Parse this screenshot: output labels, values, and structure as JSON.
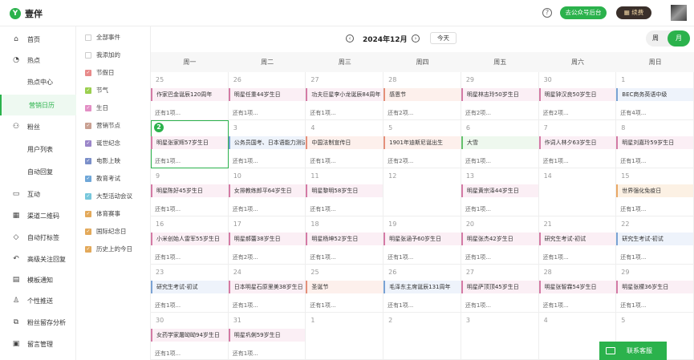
{
  "app": {
    "name": "壹伴",
    "logo_glyph": "Y"
  },
  "topbar": {
    "help_icon": "?",
    "back_button": "去公众号后台",
    "renew_button": "续费"
  },
  "sidebar": {
    "items": [
      {
        "icon": "⌂",
        "label": "首页"
      },
      {
        "icon": "◔",
        "label": "热点"
      },
      {
        "icon": "",
        "label": "热点中心"
      },
      {
        "icon": "",
        "label": "营销日历"
      },
      {
        "icon": "⚇",
        "label": "粉丝"
      },
      {
        "icon": "",
        "label": "用户列表"
      },
      {
        "icon": "",
        "label": "自动回复"
      },
      {
        "icon": "▭",
        "label": "互动"
      },
      {
        "icon": "▦",
        "label": "渠道二维码"
      },
      {
        "icon": "◇",
        "label": "自动打标签"
      },
      {
        "icon": "↶",
        "label": "高级关注回复"
      },
      {
        "icon": "▤",
        "label": "模板通知"
      },
      {
        "icon": "♙",
        "label": "个性推送"
      },
      {
        "icon": "⧉",
        "label": "粉丝留存分析"
      },
      {
        "icon": "▣",
        "label": "留言管理"
      }
    ]
  },
  "filters": [
    {
      "label": "全部事件",
      "checked": false,
      "color": "#ffffff"
    },
    {
      "label": "我添加的",
      "checked": false,
      "color": "#ffffff"
    },
    {
      "label": "节假日",
      "checked": true,
      "color": "#e88a8a"
    },
    {
      "label": "节气",
      "checked": true,
      "color": "#9bcf4f"
    },
    {
      "label": "生日",
      "checked": true,
      "color": "#e38fc5"
    },
    {
      "label": "营销节点",
      "checked": true,
      "color": "#c9a092"
    },
    {
      "label": "诞世纪念",
      "checked": true,
      "color": "#9b86c9"
    },
    {
      "label": "电影上映",
      "checked": true,
      "color": "#7b8fc9"
    },
    {
      "label": "教育考试",
      "checked": true,
      "color": "#6fa7d8"
    },
    {
      "label": "大型活动会议",
      "checked": true,
      "color": "#77c7dc"
    },
    {
      "label": "体育赛事",
      "checked": true,
      "color": "#e3a95a"
    },
    {
      "label": "国际纪念日",
      "checked": true,
      "color": "#e3a95a"
    },
    {
      "label": "历史上的今日",
      "checked": true,
      "color": "#e3a95a"
    }
  ],
  "calendar": {
    "month_title": "2024年12月",
    "prev": "‹",
    "next": "›",
    "today_label": "今天",
    "view_week": "周",
    "view_month": "月",
    "weekdays": [
      "周一",
      "周二",
      "周三",
      "周四",
      "周五",
      "周六",
      "周日"
    ],
    "cells": [
      {
        "day": "25",
        "event": "作家巴金诞辰120周年",
        "more": "还有1项...",
        "style": ""
      },
      {
        "day": "26",
        "event": "明星任重44岁生日",
        "more": "还有1项...",
        "style": ""
      },
      {
        "day": "27",
        "event": "功夫巨星李小龙诞辰84周年",
        "more": "还有1项...",
        "style": ""
      },
      {
        "day": "28",
        "event": "感恩节",
        "more": "还有2项...",
        "style": "c-red"
      },
      {
        "day": "29",
        "event": "明星林志玲50岁生日",
        "more": "还有2项...",
        "style": ""
      },
      {
        "day": "30",
        "event": "明星钟汉良50岁生日",
        "more": "还有2项...",
        "style": ""
      },
      {
        "day": "1",
        "event": "BEC商务英语中级",
        "more": "还有4项...",
        "style": "c-gray"
      },
      {
        "day": "2",
        "event": "明星张家辉57岁生日",
        "more": "还有1项...",
        "style": "",
        "today": true
      },
      {
        "day": "3",
        "event": "公务员国考、日本语能力测试",
        "more": "还有1项...",
        "style": "c-gray"
      },
      {
        "day": "4",
        "event": "中国法制宣传日",
        "more": "还有1项...",
        "style": "c-red"
      },
      {
        "day": "5",
        "event": "1901年迪斯尼诞出生",
        "more": "还有2项...",
        "style": "c-red"
      },
      {
        "day": "6",
        "event": "大雪",
        "more": "还有1项...",
        "style": "c-green"
      },
      {
        "day": "7",
        "event": "作词人林夕63岁生日",
        "more": "还有1项...",
        "style": ""
      },
      {
        "day": "8",
        "event": "明星刘嘉玲59岁生日",
        "more": "还有1项...",
        "style": ""
      },
      {
        "day": "9",
        "event": "明星陈好45岁生日",
        "more": "还有1项...",
        "style": ""
      },
      {
        "day": "10",
        "event": "女排教练郎平64岁生日",
        "more": "还有1项...",
        "style": ""
      },
      {
        "day": "11",
        "event": "明星黎明58岁生日",
        "more": "还有1项...",
        "style": ""
      },
      {
        "day": "12",
        "event": "",
        "more": "",
        "style": ""
      },
      {
        "day": "13",
        "event": "明星黄宗泽44岁生日",
        "more": "还有1项...",
        "style": ""
      },
      {
        "day": "14",
        "event": "",
        "more": "",
        "style": ""
      },
      {
        "day": "15",
        "event": "世界强化免疫日",
        "more": "还有1项...",
        "style": "c-orange"
      },
      {
        "day": "16",
        "event": "小米创始人雷军55岁生日",
        "more": "还有1项...",
        "style": ""
      },
      {
        "day": "17",
        "event": "明星郝蕾38岁生日",
        "more": "还有2项...",
        "style": ""
      },
      {
        "day": "18",
        "event": "明星杨坤52岁生日",
        "more": "还有1项...",
        "style": ""
      },
      {
        "day": "19",
        "event": "明星张涵予60岁生日",
        "more": "还有1项...",
        "style": ""
      },
      {
        "day": "20",
        "event": "明星张杰42岁生日",
        "more": "还有1项...",
        "style": ""
      },
      {
        "day": "21",
        "event": "研究生考试-初试",
        "more": "还有1项...",
        "style": ""
      },
      {
        "day": "22",
        "event": "研究生考试-初试",
        "more": "还有1项...",
        "style": "c-gray"
      },
      {
        "day": "23",
        "event": "研究生考试-初试",
        "more": "还有1项...",
        "style": "c-gray"
      },
      {
        "day": "24",
        "event": "日本明星石原里美38岁生日",
        "more": "还有1项...",
        "style": ""
      },
      {
        "day": "25",
        "event": "圣诞节",
        "more": "还有1项...",
        "style": "c-red"
      },
      {
        "day": "26",
        "event": "毛泽东主席诞辰131周年",
        "more": "还有1项...",
        "style": "c-gray"
      },
      {
        "day": "27",
        "event": "明星萨顶顶45岁生日",
        "more": "还有1项...",
        "style": ""
      },
      {
        "day": "28",
        "event": "明星张智霖54岁生日",
        "more": "还有1项...",
        "style": ""
      },
      {
        "day": "29",
        "event": "明星张檬36岁生日",
        "more": "还有1项...",
        "style": ""
      },
      {
        "day": "30",
        "event": "女药学家屠呦呦94岁生日",
        "more": "还有1项...",
        "style": ""
      },
      {
        "day": "31",
        "event": "明星巩俐59岁生日",
        "more": "还有1项...",
        "style": ""
      },
      {
        "day": "1",
        "event": "",
        "more": "",
        "style": ""
      },
      {
        "day": "2",
        "event": "",
        "more": "",
        "style": ""
      },
      {
        "day": "3",
        "event": "",
        "more": "",
        "style": ""
      },
      {
        "day": "4",
        "event": "",
        "more": "",
        "style": ""
      },
      {
        "day": "5",
        "event": "",
        "more": "",
        "style": ""
      }
    ]
  },
  "contact": {
    "label": "联系客服"
  }
}
